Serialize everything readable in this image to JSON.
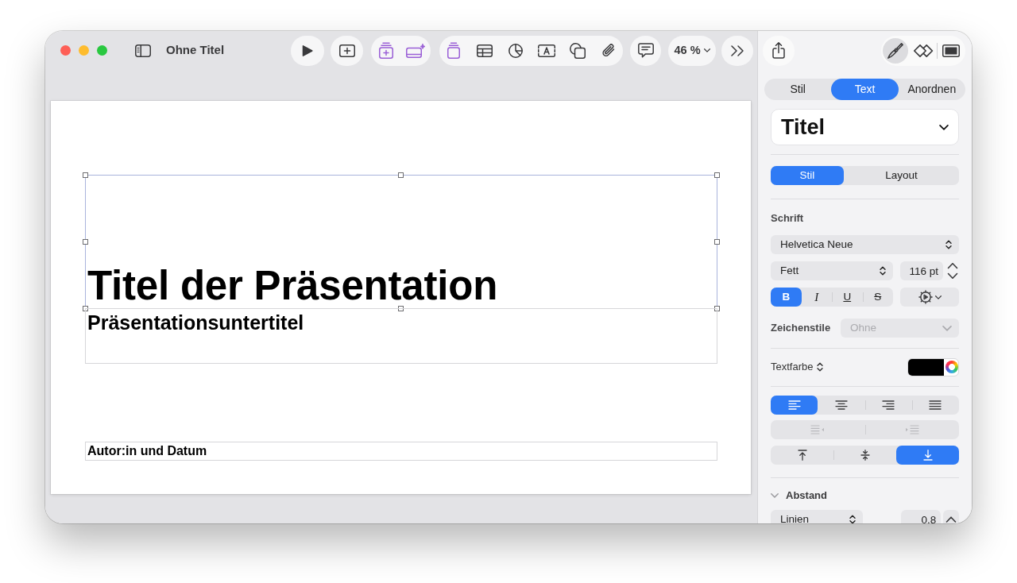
{
  "window": {
    "title": "Ohne Titel"
  },
  "toolbar": {
    "zoom": "46 %"
  },
  "slide": {
    "text_boxes": [
      {
        "kind": "title",
        "text": "Titel der Präsentation",
        "selected": true
      },
      {
        "kind": "subtitle",
        "text": "Präsentationsuntertitel",
        "selected": false
      },
      {
        "kind": "author",
        "text": "Autor:in und Datum",
        "selected": false
      }
    ]
  },
  "inspector": {
    "modes": [
      {
        "kind": "format",
        "selected": true
      },
      {
        "kind": "animate",
        "selected": false
      },
      {
        "kind": "document",
        "selected": false
      }
    ],
    "tabs": [
      {
        "label": "Stil",
        "selected": false
      },
      {
        "label": "Text",
        "selected": true
      },
      {
        "label": "Anordnen",
        "selected": false
      }
    ],
    "paragraph_style": "Titel",
    "subtabs": [
      {
        "label": "Stil",
        "selected": true
      },
      {
        "label": "Layout",
        "selected": false
      }
    ],
    "font": {
      "heading": "Schrift",
      "family": "Helvetica Neue",
      "typeface": "Fett",
      "size": "116 pt",
      "styles": [
        {
          "kind": "bold",
          "label": "B",
          "selected": true
        },
        {
          "kind": "italic",
          "label": "I",
          "selected": false
        },
        {
          "kind": "underline",
          "label": "U",
          "selected": false
        },
        {
          "kind": "strike",
          "label": "S",
          "selected": false
        }
      ]
    },
    "character_styles": {
      "label": "Zeichenstile",
      "value": "Ohne",
      "disabled": true
    },
    "text_color": {
      "label": "Textfarbe",
      "color": "#000000"
    },
    "alignment": [
      {
        "kind": "left",
        "selected": true
      },
      {
        "kind": "center",
        "selected": false
      },
      {
        "kind": "right",
        "selected": false
      },
      {
        "kind": "justify",
        "selected": false
      }
    ],
    "indent": [
      {
        "kind": "decrease",
        "disabled": true
      },
      {
        "kind": "increase",
        "disabled": true
      }
    ],
    "vertical_alignment": [
      {
        "kind": "top",
        "selected": false
      },
      {
        "kind": "middle",
        "selected": false
      },
      {
        "kind": "bottom",
        "selected": true
      }
    ],
    "spacing": {
      "heading": "Abstand",
      "expanded": true,
      "mode": "Linien",
      "value": "0.8"
    }
  }
}
